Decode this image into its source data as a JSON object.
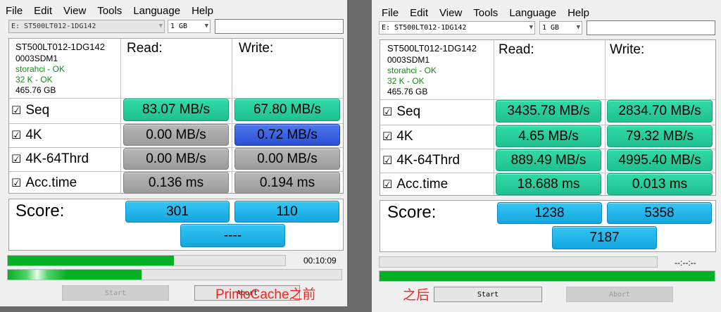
{
  "menu": [
    "File",
    "Edit",
    "View",
    "Tools",
    "Language",
    "Help"
  ],
  "columns": {
    "read": "Read:",
    "write": "Write:"
  },
  "rows": [
    "Seq",
    "4K",
    "4K-64Thrd",
    "Acc.time"
  ],
  "checkbox_glyph": "☑",
  "score_label": "Score:",
  "buttons": {
    "start": "Start",
    "abort": "Abort"
  },
  "colors": {
    "result_green": "#22c998",
    "result_gray": "#a8a8a8",
    "result_blue": "#3a5fe0",
    "score_cyan": "#1fb4e8",
    "progress_green": "#06b025",
    "annotation_red": "#ff2020"
  },
  "left": {
    "drive": "E: ST500LT012-1DG142",
    "size": "1 GB",
    "info": {
      "model": "ST500LT012-1DG142",
      "firmware": "0003SDM1",
      "driver": "storahci - OK",
      "align": "32 K - OK",
      "capacity": "465.76 GB"
    },
    "results": [
      {
        "read": "83.07 MB/s",
        "write": "67.80 MB/s"
      },
      {
        "read": "0.00 MB/s",
        "write": "0.72 MB/s"
      },
      {
        "read": "0.00 MB/s",
        "write": "0.00 MB/s"
      },
      {
        "read": "0.136 ms",
        "write": "0.194 ms"
      }
    ],
    "score": {
      "read": "301",
      "write": "110",
      "total": "----"
    },
    "progress_main": 0.6,
    "progress_sub": 0.4,
    "timer": "00:10:09",
    "annotation": "PrimoCache之前"
  },
  "right": {
    "drive": "E: ST500LT012-1DG142",
    "size": "1 GB",
    "info": {
      "model": "ST500LT012-1DG142",
      "firmware": "0003SDM1",
      "driver": "storahci - OK",
      "align": "32 K - OK",
      "capacity": "465.76 GB"
    },
    "results": [
      {
        "read": "3435.78 MB/s",
        "write": "2834.70 MB/s"
      },
      {
        "read": "4.65 MB/s",
        "write": "79.32 MB/s"
      },
      {
        "read": "889.49 MB/s",
        "write": "4995.40 MB/s"
      },
      {
        "read": "18.688 ms",
        "write": "0.013 ms"
      }
    ],
    "score": {
      "read": "1238",
      "write": "5358",
      "total": "7187"
    },
    "progress_main": 0,
    "progress_sub": 1,
    "timer": "--:--:--",
    "annotation": "之后"
  }
}
